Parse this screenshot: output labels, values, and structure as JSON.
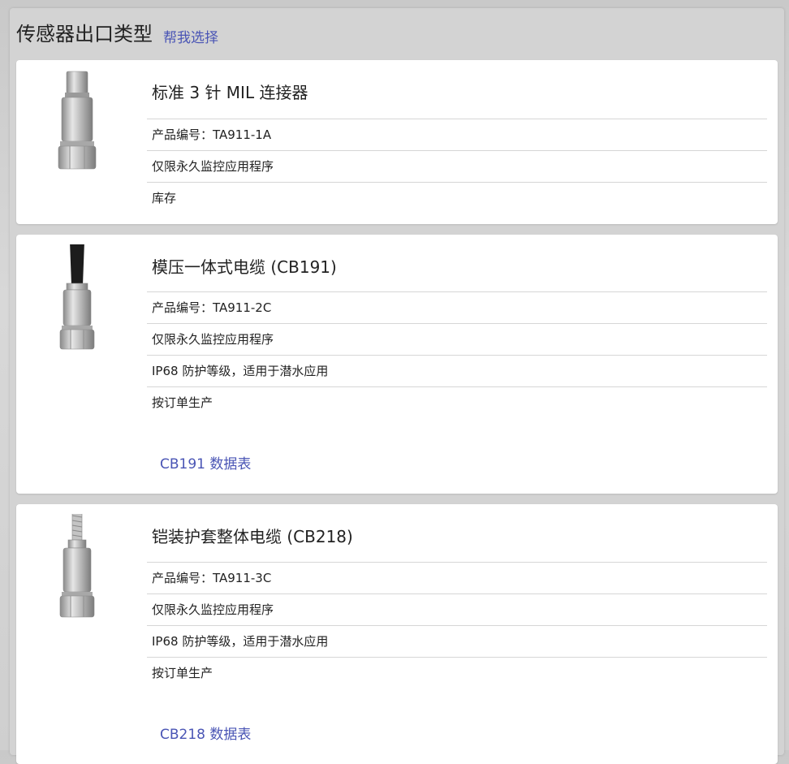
{
  "header": {
    "title": "传感器出口类型",
    "help_link": "帮我选择"
  },
  "products": [
    {
      "title": "标准 3 针 MIL 连接器",
      "specs": [
        "产品编号：TA911-1A",
        "仅限永久监控应用程序",
        "库存"
      ],
      "image": "mil-connector-sensor-icon"
    },
    {
      "title": "模压一体式电缆 (CB191)",
      "specs": [
        "产品编号：TA911-2C",
        "仅限永久监控应用程序",
        "IP68 防护等级，适用于潜水应用",
        "按订单生产"
      ],
      "datasheet": "CB191 数据表",
      "image": "molded-cable-sensor-icon"
    },
    {
      "title": "铠装护套整体电缆 (CB218)",
      "specs": [
        "产品编号：TA911-3C",
        "仅限永久监控应用程序",
        "IP68 防护等级，适用于潜水应用",
        "按订单生产"
      ],
      "datasheet": "CB218 数据表",
      "image": "armored-cable-sensor-icon"
    }
  ],
  "colors": {
    "link": "#4a55b5",
    "panel": "#d3d3d3",
    "card": "#ffffff"
  }
}
